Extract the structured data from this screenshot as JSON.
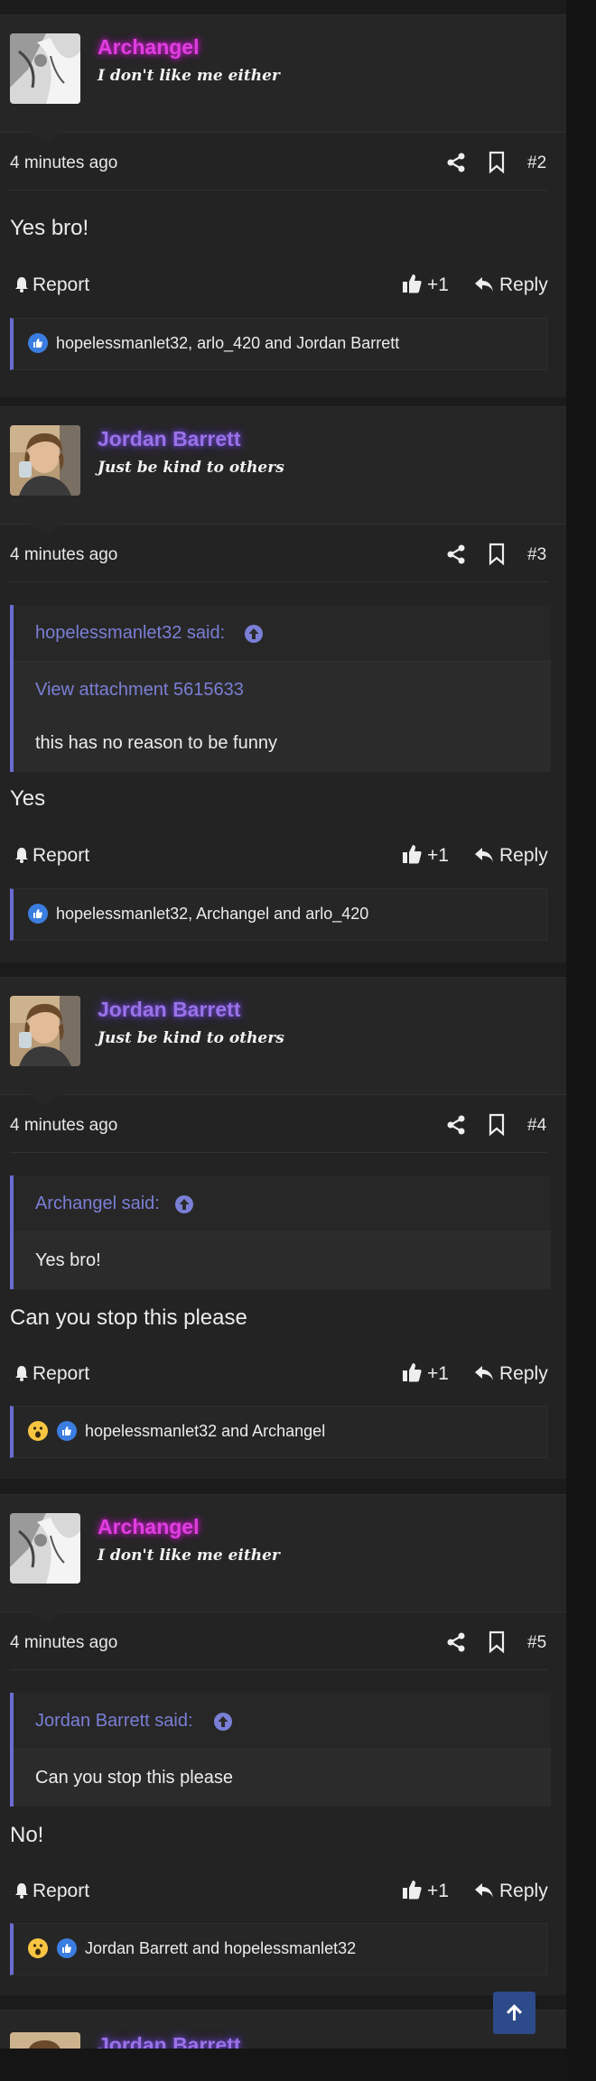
{
  "posts": [
    {
      "username": "Archangel",
      "user_title": "I don't like me either",
      "time": "4 minutes ago",
      "number": "#2",
      "message": "Yes bro!",
      "actions": {
        "report": "Report",
        "like": "+1",
        "reply": "Reply"
      },
      "reactions": "hopelessmanlet32, arlo_420 and Jordan Barrett"
    },
    {
      "username": "Jordan Barrett",
      "user_title": "Just be kind to others",
      "time": "4 minutes ago",
      "number": "#3",
      "quote": {
        "author": "hopelessmanlet32 said:",
        "attachment": "View attachment 5615633",
        "text": "this has no reason to be funny"
      },
      "message": "Yes",
      "actions": {
        "report": "Report",
        "like": "+1",
        "reply": "Reply"
      },
      "reactions": "hopelessmanlet32, Archangel and arlo_420"
    },
    {
      "username": "Jordan Barrett",
      "user_title": "Just be kind to others",
      "time": "4 minutes ago",
      "number": "#4",
      "quote": {
        "author": "Archangel said:",
        "text": "Yes bro!"
      },
      "message": "Can you stop this please",
      "actions": {
        "report": "Report",
        "like": "+1",
        "reply": "Reply"
      },
      "reactions": "hopelessmanlet32 and Archangel"
    },
    {
      "username": "Archangel",
      "user_title": "I don't like me either",
      "time": "4 minutes ago",
      "number": "#5",
      "quote": {
        "author": "Jordan Barrett said:",
        "text": "Can you stop this please"
      },
      "message": "No!",
      "actions": {
        "report": "Report",
        "like": "+1",
        "reply": "Reply"
      },
      "reactions": "Jordan Barrett and hopelessmanlet32"
    }
  ],
  "next_post": {
    "username": "Jordan Barrett"
  },
  "colors": {
    "archangel": "#e03ee0",
    "jordan": "#9a72e8",
    "accent": "#6b6bd3",
    "scroll_button": "#2d4a8a"
  }
}
